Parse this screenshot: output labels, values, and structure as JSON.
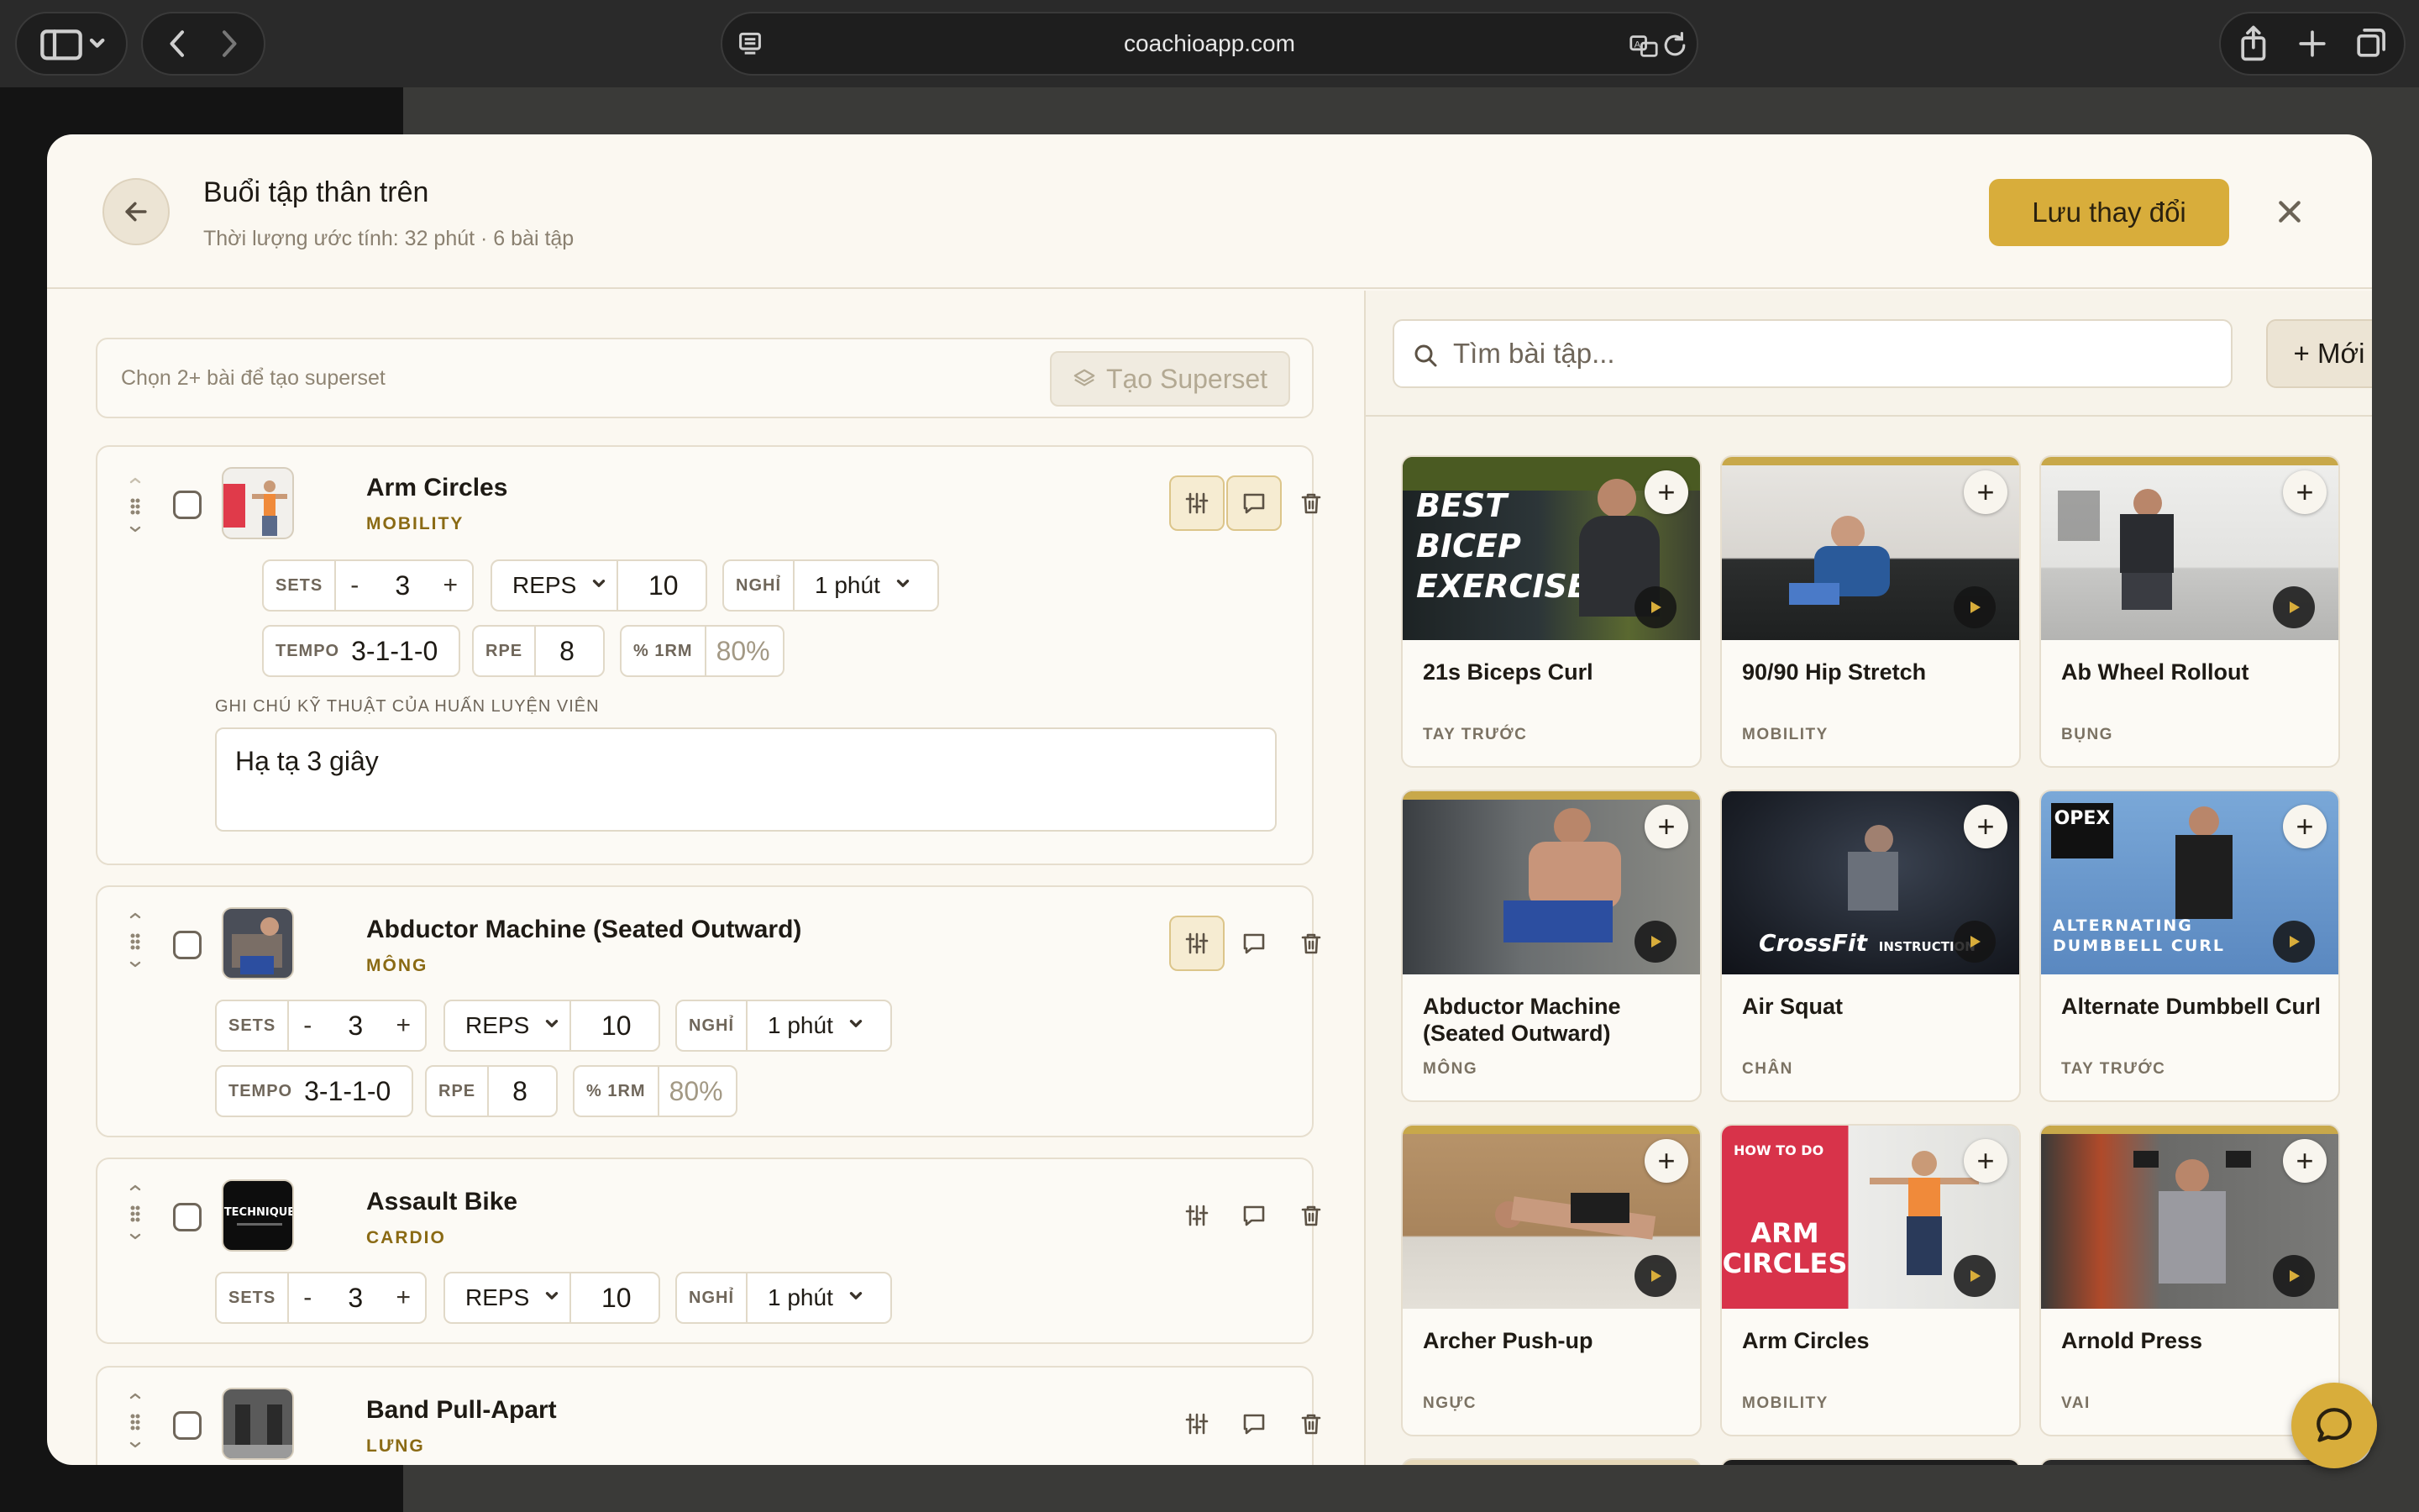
{
  "browser": {
    "url": "coachioapp.com"
  },
  "header": {
    "title": "Buổi tập thân trên",
    "subtitle": "Thời lượng ước tính: 32 phút · 6 bài tập",
    "save_label": "Lưu thay đổi"
  },
  "superset": {
    "hint": "Chọn 2+ bài để tạo superset",
    "button_label": "Tạo Superset"
  },
  "labels": {
    "sets": "SETS",
    "reps": "REPS",
    "rest": "NGHỈ",
    "tempo": "TEMPO",
    "rpe": "RPE",
    "pct_1rm": "% 1RM",
    "minus": "-",
    "plus": "+",
    "notes_label": "GHI CHÚ KỸ THUẬT CỦA HUẤN LUYỆN VIÊN"
  },
  "exercises": [
    {
      "name": "Arm Circles",
      "category": "MOBILITY",
      "sets": "3",
      "reps": "10",
      "rest": "1 phút",
      "tempo": "3-1-1-0",
      "rpe": "8",
      "pct_1rm_placeholder": "80%",
      "notes": "Hạ tạ 3 giây"
    },
    {
      "name": "Abductor Machine (Seated Outward)",
      "category": "MÔNG",
      "sets": "3",
      "reps": "10",
      "rest": "1 phút",
      "tempo": "3-1-1-0",
      "rpe": "8",
      "pct_1rm_placeholder": "80%"
    },
    {
      "name": "Assault Bike",
      "category": "CARDIO",
      "sets": "3",
      "reps": "10",
      "rest": "1 phút",
      "thumb_text": "TECHNIQUE"
    },
    {
      "name": "Band Pull-Apart",
      "category": "LƯNG"
    }
  ],
  "library": {
    "search_placeholder": "Tìm bài tập...",
    "new_label": "+ Mới",
    "items": [
      {
        "name": "21s Biceps Curl",
        "category": "TAY TRƯỚC",
        "overlay": [
          "BEST",
          "BICEP",
          "EXERCISE"
        ]
      },
      {
        "name": "90/90 Hip Stretch",
        "category": "MOBILITY"
      },
      {
        "name": "Ab Wheel Rollout",
        "category": "BỤNG"
      },
      {
        "name": "Abductor Machine (Seated Outward)",
        "category": "MÔNG"
      },
      {
        "name": "Air Squat",
        "category": "CHÂN",
        "overlay": [
          "CrossFit",
          "INSTRUCTION"
        ]
      },
      {
        "name": "Alternate Dumbbell Curl",
        "category": "TAY TRƯỚC",
        "overlay": [
          "OPEX",
          "ALTERNATING",
          "DUMBBELL CURL"
        ]
      },
      {
        "name": "Archer Push-up",
        "category": "NGỰC"
      },
      {
        "name": "Arm Circles",
        "category": "MOBILITY",
        "overlay": [
          "HOW TO DO",
          "ARM",
          "CIRCLES"
        ]
      },
      {
        "name": "Arnold Press",
        "category": "VAI"
      }
    ]
  },
  "colors": {
    "accent": "#d8ad3b",
    "category_text": "#8a6a14",
    "modal_bg": "#fbf8f1"
  }
}
